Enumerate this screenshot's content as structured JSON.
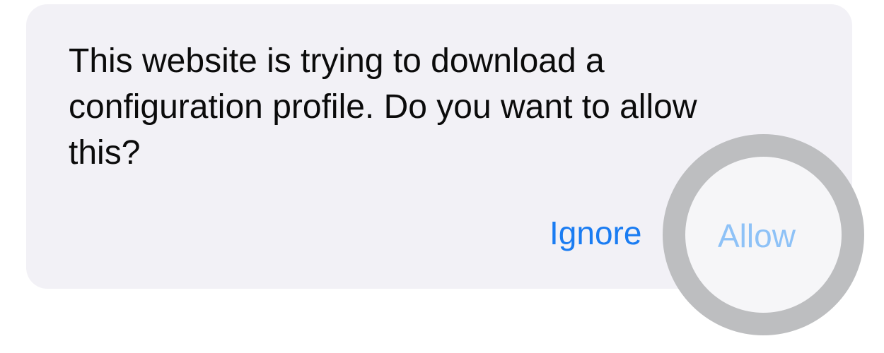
{
  "dialog": {
    "message": "This website is trying to download a configuration profile. Do you want to allow this?",
    "ignore_label": "Ignore",
    "allow_label": "Allow"
  },
  "colors": {
    "dialog_background": "#f2f1f6",
    "ignore_text": "#1a7cf2",
    "allow_text_pressed": "#8ec2f7",
    "highlight_ring": "#bdbec0"
  }
}
